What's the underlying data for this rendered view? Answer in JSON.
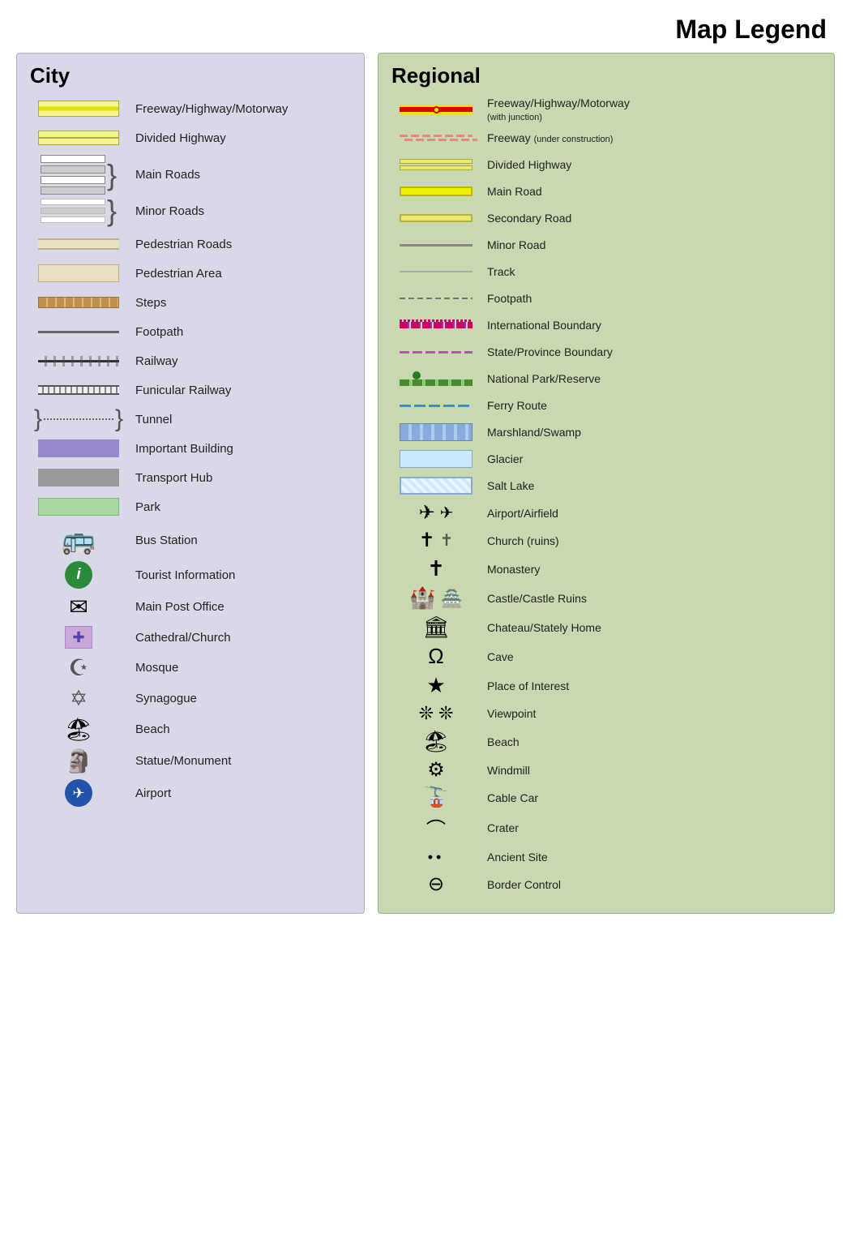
{
  "title": "Map Legend",
  "city": {
    "title": "City",
    "items": [
      {
        "id": "freeway",
        "label": "Freeway/Highway/Motorway"
      },
      {
        "id": "divided-highway",
        "label": "Divided Highway"
      },
      {
        "id": "main-roads",
        "label": "Main Roads"
      },
      {
        "id": "minor-roads",
        "label": "Minor Roads"
      },
      {
        "id": "pedestrian-roads",
        "label": "Pedestrian Roads"
      },
      {
        "id": "pedestrian-area",
        "label": "Pedestrian Area"
      },
      {
        "id": "steps",
        "label": "Steps"
      },
      {
        "id": "footpath",
        "label": "Footpath"
      },
      {
        "id": "railway",
        "label": "Railway"
      },
      {
        "id": "funicular",
        "label": "Funicular Railway"
      },
      {
        "id": "tunnel",
        "label": "Tunnel"
      },
      {
        "id": "important-building",
        "label": "Important Building"
      },
      {
        "id": "transport-hub",
        "label": "Transport Hub"
      },
      {
        "id": "park",
        "label": "Park"
      },
      {
        "id": "bus-station",
        "label": "Bus Station"
      },
      {
        "id": "tourist-info",
        "label": "Tourist Information"
      },
      {
        "id": "post-office",
        "label": "Main Post Office"
      },
      {
        "id": "cathedral",
        "label": "Cathedral/Church"
      },
      {
        "id": "mosque",
        "label": "Mosque"
      },
      {
        "id": "synagogue",
        "label": "Synagogue"
      },
      {
        "id": "beach",
        "label": "Beach"
      },
      {
        "id": "statue",
        "label": "Statue/Monument"
      },
      {
        "id": "airport",
        "label": "Airport"
      }
    ]
  },
  "regional": {
    "title": "Regional",
    "items": [
      {
        "id": "reg-freeway",
        "label": "Freeway/Highway/Motorway",
        "sublabel": "(with junction)"
      },
      {
        "id": "reg-freeway-construction",
        "label": "Freeway",
        "sublabel": "(under construction)"
      },
      {
        "id": "reg-divided",
        "label": "Divided Highway",
        "sublabel": ""
      },
      {
        "id": "reg-main-road",
        "label": "Main Road",
        "sublabel": ""
      },
      {
        "id": "reg-secondary-road",
        "label": "Secondary Road",
        "sublabel": ""
      },
      {
        "id": "reg-minor-road",
        "label": "Minor Road",
        "sublabel": ""
      },
      {
        "id": "reg-track",
        "label": "Track",
        "sublabel": ""
      },
      {
        "id": "reg-footpath",
        "label": "Footpath",
        "sublabel": ""
      },
      {
        "id": "reg-intl-boundary",
        "label": "International Boundary",
        "sublabel": ""
      },
      {
        "id": "reg-state-boundary",
        "label": "State/Province Boundary",
        "sublabel": ""
      },
      {
        "id": "reg-national-park",
        "label": "National Park/Reserve",
        "sublabel": ""
      },
      {
        "id": "reg-ferry",
        "label": "Ferry Route",
        "sublabel": ""
      },
      {
        "id": "reg-marshland",
        "label": "Marshland/Swamp",
        "sublabel": ""
      },
      {
        "id": "reg-glacier",
        "label": "Glacier",
        "sublabel": ""
      },
      {
        "id": "reg-salt-lake",
        "label": "Salt Lake",
        "sublabel": ""
      },
      {
        "id": "reg-airport",
        "label": "Airport/Airfield",
        "sublabel": ""
      },
      {
        "id": "reg-church",
        "label": "Church (ruins)",
        "sublabel": ""
      },
      {
        "id": "reg-monastery",
        "label": "Monastery",
        "sublabel": ""
      },
      {
        "id": "reg-castle",
        "label": "Castle/Castle Ruins",
        "sublabel": ""
      },
      {
        "id": "reg-chateau",
        "label": "Chateau/Stately Home",
        "sublabel": ""
      },
      {
        "id": "reg-cave",
        "label": "Cave",
        "sublabel": ""
      },
      {
        "id": "reg-place-interest",
        "label": "Place of Interest",
        "sublabel": ""
      },
      {
        "id": "reg-viewpoint",
        "label": "Viewpoint",
        "sublabel": ""
      },
      {
        "id": "reg-beach",
        "label": "Beach",
        "sublabel": ""
      },
      {
        "id": "reg-windmill",
        "label": "Windmill",
        "sublabel": ""
      },
      {
        "id": "reg-cable-car",
        "label": "Cable Car",
        "sublabel": ""
      },
      {
        "id": "reg-crater",
        "label": "Crater",
        "sublabel": ""
      },
      {
        "id": "reg-ancient-site",
        "label": "Ancient Site",
        "sublabel": ""
      },
      {
        "id": "reg-border-control",
        "label": "Border Control",
        "sublabel": ""
      }
    ]
  }
}
